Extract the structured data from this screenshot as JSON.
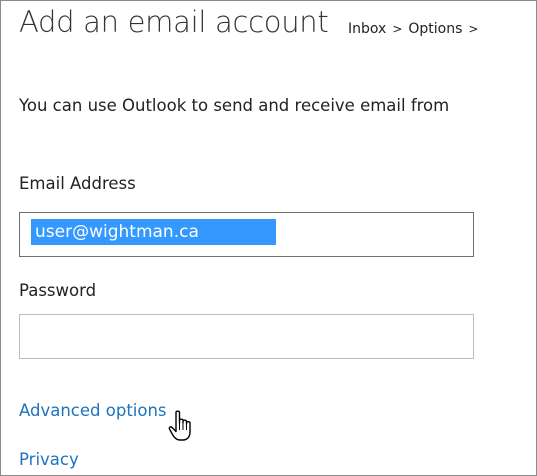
{
  "header": {
    "title": "Add an email account",
    "breadcrumb": [
      "Inbox",
      "Options"
    ],
    "separator": ">"
  },
  "intro": {
    "text": "You can use Outlook to send and receive email from"
  },
  "form": {
    "email_label": "Email Address",
    "email_value": "user@wightman.ca",
    "password_label": "Password",
    "password_value": ""
  },
  "links": {
    "advanced_options": "Advanced options",
    "privacy": "Privacy"
  },
  "cursor": {
    "icon": "hand-pointer-icon"
  },
  "colors": {
    "link": "#1e73be",
    "selection": "#3399ff",
    "text": "#222222"
  }
}
